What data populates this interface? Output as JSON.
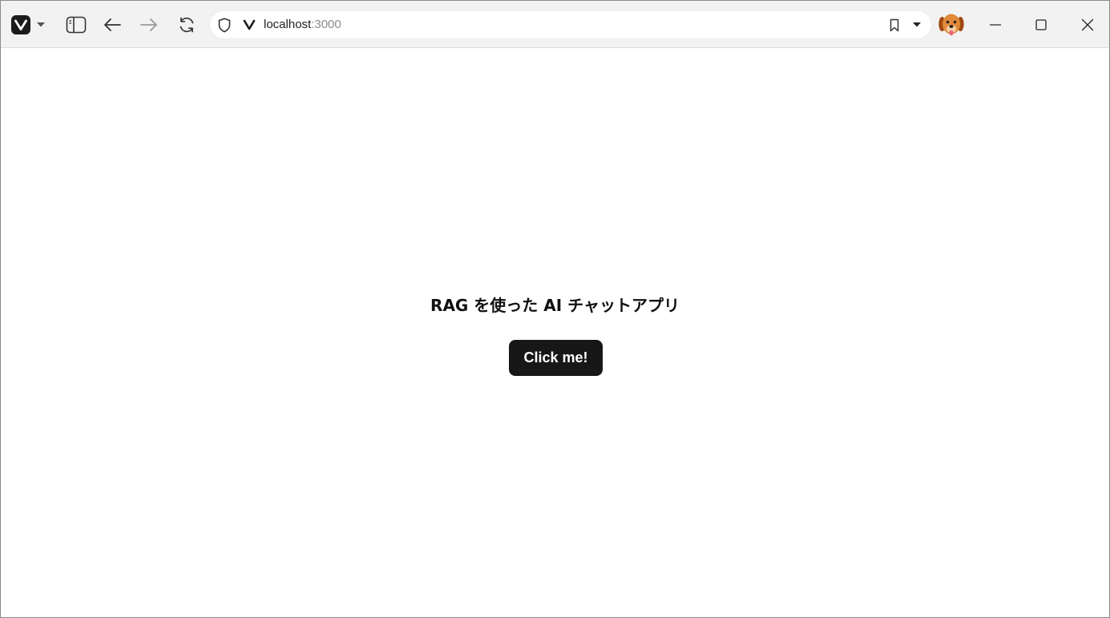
{
  "browser": {
    "address_bar": {
      "host": "localhost",
      "port": ":3000"
    },
    "icons": {
      "logo": "vivaldi-icon",
      "menu": "chevron-down-icon",
      "panel": "sidebar-panel-icon",
      "back": "arrow-left-icon",
      "forward": "arrow-right-icon",
      "reload": "reload-icon",
      "security": "shield-icon",
      "bookmark": "bookmark-icon",
      "profile": "dog-avatar"
    }
  },
  "page": {
    "title": "RAG を使った AI チャットアプリ",
    "button_label": "Click me!"
  },
  "colors": {
    "button_bg": "#171717",
    "button_text": "#ffffff",
    "toolbar_bg": "#f2f2f2"
  }
}
